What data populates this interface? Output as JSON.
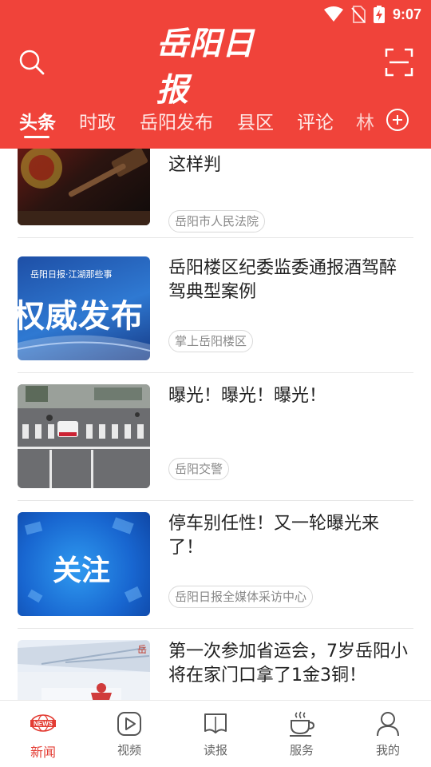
{
  "status": {
    "time": "9:07"
  },
  "header": {
    "logo": "岳阳日报",
    "search_icon": "search-icon",
    "scan_icon": "scan-icon"
  },
  "tabs": [
    {
      "label": "头条",
      "active": true
    },
    {
      "label": "时政"
    },
    {
      "label": "岳阳发布"
    },
    {
      "label": "县区"
    },
    {
      "label": "评论"
    },
    {
      "label": "林"
    }
  ],
  "articles": [
    {
      "title": "这样判",
      "source": "岳阳市人民法院",
      "thumb": "gavel"
    },
    {
      "title": "岳阳楼区纪委监委通报酒驾醉驾典型案例",
      "source": "掌上岳阳楼区",
      "thumb": "authority",
      "thumb_caption": "岳阳日报·江湖那些事",
      "thumb_text": "权威发布"
    },
    {
      "title": "曝光！曝光！曝光！",
      "source": "岳阳交警",
      "thumb": "crosswalk"
    },
    {
      "title": "停车别任性！又一轮曝光来了！",
      "source": "岳阳日报全媒体采访中心",
      "thumb": "attention",
      "thumb_text": "关注"
    },
    {
      "title": "第一次参加省运会，7岁岳阳小将在家门口拿了1金3铜！",
      "source": "",
      "thumb": "gym"
    }
  ],
  "bottom_nav": [
    {
      "label": "新闻",
      "icon": "news-icon",
      "active": true
    },
    {
      "label": "视频",
      "icon": "video-icon"
    },
    {
      "label": "读报",
      "icon": "newspaper-icon"
    },
    {
      "label": "服务",
      "icon": "coffee-icon"
    },
    {
      "label": "我的",
      "icon": "profile-icon"
    }
  ],
  "colors": {
    "brand": "#f0433a",
    "active_nav": "#e33b32"
  }
}
